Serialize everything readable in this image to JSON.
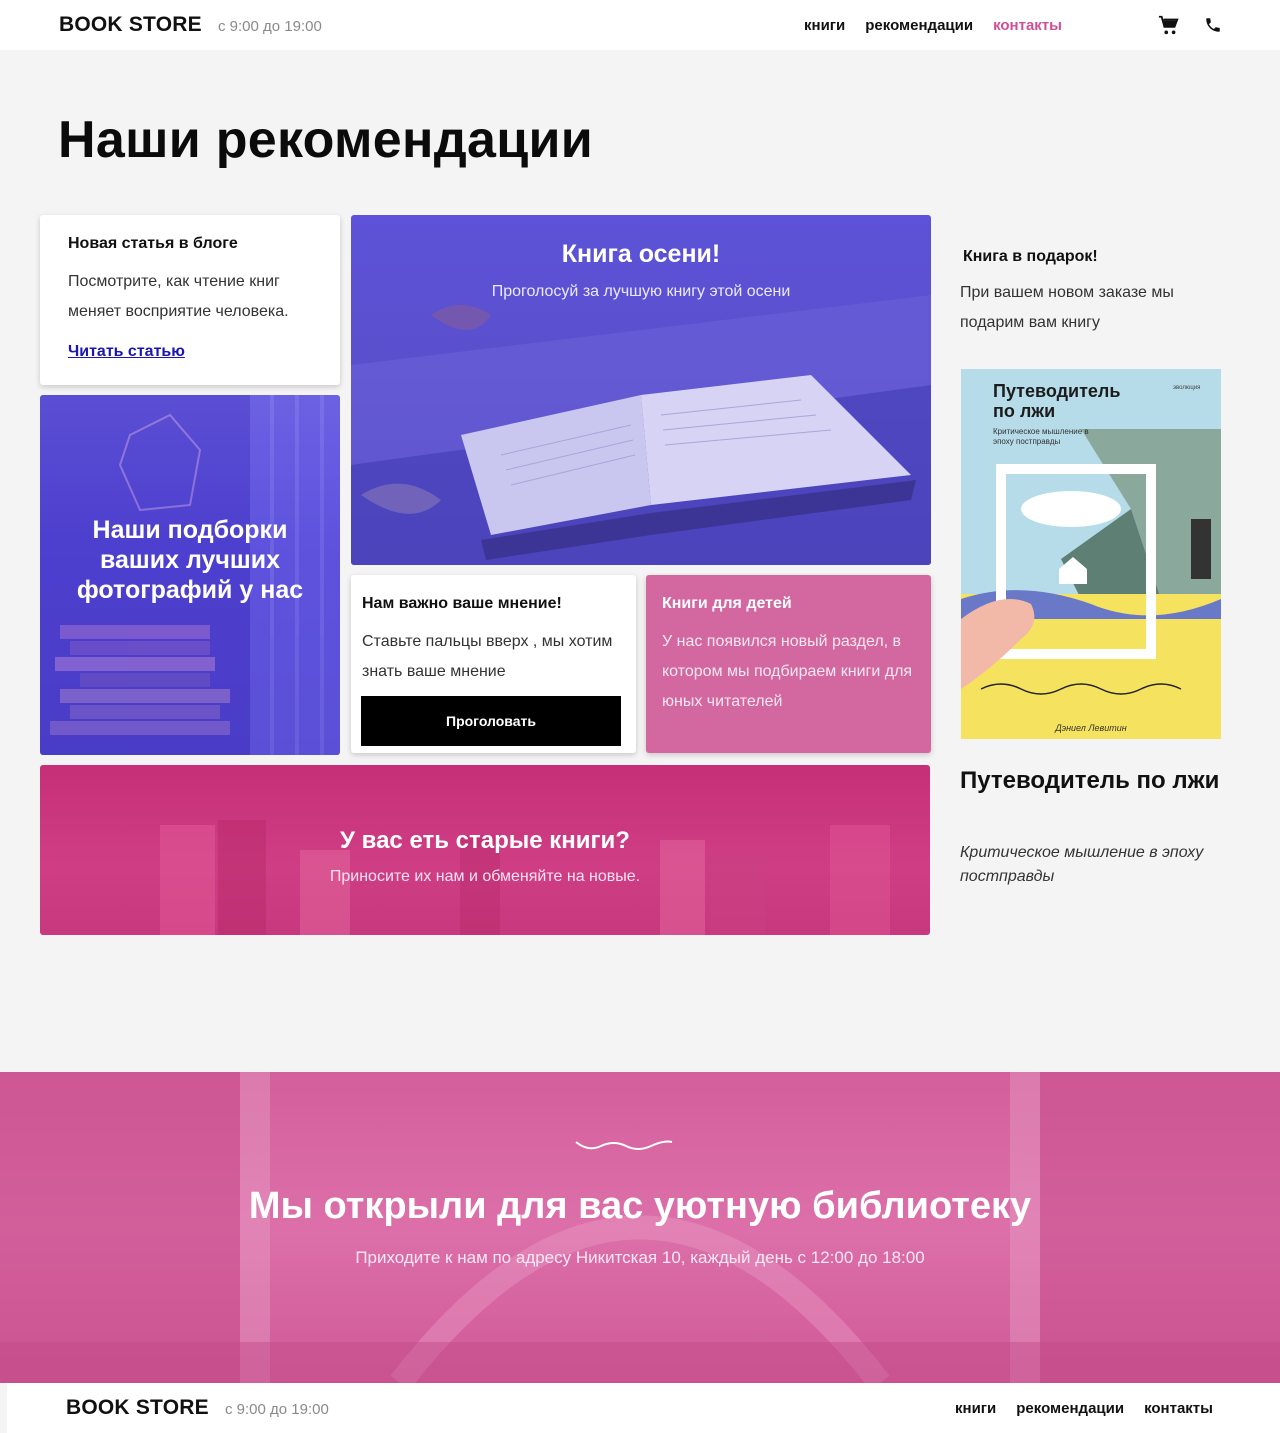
{
  "header": {
    "logo": "BOOK STORE",
    "hours": "с 9:00 до 19:00",
    "nav": [
      "книги",
      "рекомендации",
      "контакты"
    ],
    "active_nav": "контакты",
    "icons": [
      "cart-icon",
      "phone-icon"
    ]
  },
  "page_title": "Наши рекомендации",
  "blog_card": {
    "title": "Новая статья в блоге",
    "text": "Посмотрите, как чтение книг меняет восприятие человека.",
    "link": "Читать статью"
  },
  "photos_card": {
    "title": "Наши подборки ваших лучших фотографий у нас"
  },
  "autumn_card": {
    "title": "Книга осени!",
    "text": "Проголосуй за лучшую книгу этой осени"
  },
  "opinion_card": {
    "title": "Нам важно ваше мнение!",
    "text": "Ставьте пальцы вверх , мы хотим знать ваше мнение",
    "button": "Проголовать"
  },
  "kids_card": {
    "title": "Книги для детей",
    "text": "У нас появился новый раздел, в котором мы подбираем книги для юных читателей"
  },
  "old_books_card": {
    "title": "У вас еть старые книги?",
    "text": "Приносите их нам и обменяйте на новые."
  },
  "gift": {
    "title": "Книга в подарок!",
    "text": "При вашем новом заказе мы подарим вам книгу",
    "cover": {
      "title": "Путеводитель по лжи",
      "subtitle": "Критическое мышление в эпоху постправды",
      "author": "Дэниел Левитин",
      "publisher": "эволюция"
    },
    "book_title": "Путеводитель по лжи",
    "book_subtitle": "Критическое мышление в эпоху постправды"
  },
  "library": {
    "title": "Мы открыли для вас уютную библиотеку",
    "text": "Приходите к нам по адресу Никитская 10, каждый день с 12:00 до 18:00"
  },
  "footer": {
    "logo": "BOOK STORE",
    "hours": "с 9:00 до 19:00",
    "nav": [
      "книги",
      "рекомендации",
      "контакты"
    ]
  },
  "colors": {
    "accent_pink": "#d14e96",
    "card_pink": "#d2689f",
    "violet": "#5a50cc",
    "link_blue": "#1a16b0"
  }
}
